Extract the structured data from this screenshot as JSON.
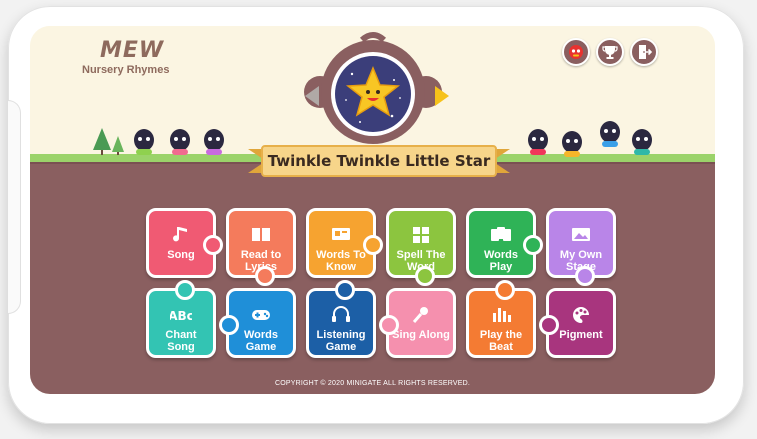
{
  "app": {
    "logo_main": "MEW",
    "logo_sub": "Nursery Rhymes",
    "title": "Twinkle Twinkle Little Star",
    "copyright": "COPYRIGHT © 2020 MINIGATE ALL RIGHTS RESERVED."
  },
  "top_icons": [
    {
      "name": "character-avatar-icon"
    },
    {
      "name": "trophy-icon"
    },
    {
      "name": "exit-icon"
    }
  ],
  "tiles_row1": [
    {
      "label": "Song",
      "color": "#f05a73",
      "icon": "music-note-icon"
    },
    {
      "label": "Read to\nLyrics",
      "color": "#f47b5c",
      "icon": "book-icon"
    },
    {
      "label": "Words To\nKnow",
      "color": "#f6a330",
      "icon": "flashcard-icon"
    },
    {
      "label": "Spell The\nWord",
      "color": "#8cc53f",
      "icon": "blocks-icon"
    },
    {
      "label": "Words\nPlay",
      "color": "#2fb357",
      "icon": "cards-icon"
    },
    {
      "label": "My Own\nStage",
      "color": "#b985e8",
      "icon": "picture-icon"
    }
  ],
  "tiles_row2": [
    {
      "label": "Chant\nSong",
      "color": "#33c4b3",
      "icon": "abc-icon"
    },
    {
      "label": "Words\nGame",
      "color": "#1f8fd8",
      "icon": "gamepad-icon"
    },
    {
      "label": "Listening\nGame",
      "color": "#1c5fa6",
      "icon": "headphones-icon"
    },
    {
      "label": "Sing Along",
      "color": "#f590ae",
      "icon": "microphone-icon"
    },
    {
      "label": "Play the\nBeat",
      "color": "#f47b33",
      "icon": "equalizer-icon"
    },
    {
      "label": "Pigment",
      "color": "#a8357e",
      "icon": "palette-icon"
    }
  ]
}
